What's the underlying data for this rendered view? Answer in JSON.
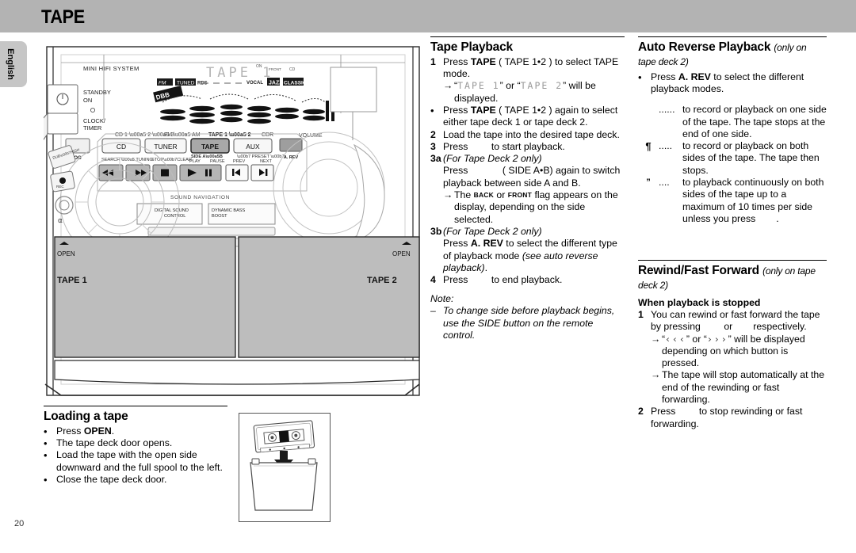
{
  "page": {
    "title": "TAPE",
    "language_tab": "English",
    "page_number": "20",
    "header_bg": "#b3b3b3"
  },
  "illustration": {
    "name": "mini-hifi-front-panel",
    "labels": {
      "brand": "MINI HIFI SYSTEM",
      "standby": "STANDBY",
      "on": "ON",
      "clock_timer_1": "CLOCK/",
      "clock_timer_2": "TIMER",
      "dubbing": "DUB· HIGH",
      "record": "REC",
      "prog": "PROG",
      "source_cd": "CD 1 ¥ 2 ¥ 3",
      "source_fm": "FM ¥ AM",
      "source_tape": "TAPE 1 ¥ 2",
      "source_cdr": "CDR",
      "btn_cd": "CD",
      "btn_tuner": "TUNER",
      "btn_tape": "TAPE",
      "btn_aux": "AUX",
      "btn_arev": "A. REV",
      "volume": "VOLUME",
      "search_tuning": "SEARCH ¥ TUNING",
      "stop_clear": "STOP·CLEAR",
      "side_ab": "SIDE A¥B",
      "play": "PLAY",
      "pause": "PAUSE",
      "preset": "· PRESET ·",
      "prev": "PREV",
      "next": "NEXT",
      "sound_navigation": "SOUND NAVIGATION",
      "dsc_1": "DIGITAL SOUND",
      "dsc_2": "CONTROL",
      "dbb_1": "DYNAMIC BASS",
      "dbb_2": "BOOST",
      "open_left": "OPEN",
      "open_right": "OPEN",
      "tape1": "TAPE 1",
      "tape2": "TAPE 2"
    },
    "display": {
      "main_text": "TAPE  1",
      "flags": [
        "FM",
        "TUNED",
        "RDS",
        "ON",
        "FRONT",
        "CD",
        "VOCAL",
        "JAZZ",
        "CLASSIC"
      ],
      "logo": "DBB"
    }
  },
  "loading_a_tape": {
    "heading": "Loading a tape",
    "bullets": [
      {
        "pre": "Press ",
        "bold": "OPEN",
        "post": "."
      },
      {
        "pre": "The tape deck door opens.",
        "bold": "",
        "post": ""
      },
      {
        "pre": "Load the tape with the open side downward and the full spool to the left.",
        "bold": "",
        "post": ""
      },
      {
        "pre": "Close the tape deck door.",
        "bold": "",
        "post": ""
      }
    ]
  },
  "tape_playback": {
    "heading": "Tape Playback",
    "steps": [
      {
        "marker": "1",
        "line1_a": "Press ",
        "line1_bold": "TAPE",
        "line1_b": " ( TAPE 1•2 ) to select TAPE mode.",
        "arrow": {
          "q1": "“",
          "lcd1": "TAPE  1",
          "q2": "” or “",
          "lcd2": "TAPE  2",
          "q3": "” will be displayed."
        }
      },
      {
        "marker": "•",
        "line1_a": "Press ",
        "line1_bold": "TAPE",
        "line1_b": " ( TAPE 1•2 ) again to select either tape deck 1 or tape deck 2."
      },
      {
        "marker": "2",
        "text": "Load the tape into the desired tape deck."
      },
      {
        "marker": "3",
        "pre": "Press ",
        "post": "to start playback."
      },
      {
        "marker": "3a",
        "italic_head": "(For Tape Deck 2 only)",
        "pre": "Press ",
        "post": "( SIDE A•B) again to switch playback between side A and B.",
        "arrow_pre": "The ",
        "arrow_sc1": "BACK",
        "arrow_mid": " or ",
        "arrow_sc2": "FRONT",
        "arrow_post": " flag appears on the display, depending on the side selected."
      },
      {
        "marker": "3b",
        "italic_head": "(For Tape Deck 2 only)",
        "pre": "Press ",
        "bold": "A. REV",
        "post": " to select the different type of playback mode ",
        "italic_tail": "(see auto reverse playback)",
        "tail_end": "."
      },
      {
        "marker": "4",
        "pre": "Press ",
        "post": "to end playback."
      }
    ],
    "note": {
      "head": "Note:",
      "items": [
        "To change side before playback begins, use the SIDE button on the remote control."
      ]
    }
  },
  "auto_reverse": {
    "heading": "Auto Reverse Playback",
    "heading_sub": "(only on tape deck 2)",
    "bullet": {
      "pre": "Press ",
      "bold": "A. REV",
      "post": " to select the different playback modes."
    },
    "modes": [
      {
        "symbol": "",
        "dots": "......",
        "text": "to record or playback on one side of the tape. The tape stops at the end of one side."
      },
      {
        "symbol": "¶",
        "dots": ".....",
        "text": "to record or playback on both sides of the tape. The tape then stops."
      },
      {
        "symbol": "”",
        "dots": "....",
        "text": "to playback continuously on both sides of the tape up to a maximum of 10 times per side unless you press",
        "trailing": "."
      }
    ]
  },
  "rewind_ff": {
    "heading": "Rewind/Fast Forward",
    "heading_sub": "(only on tape deck 2)",
    "subheading": "When playback is stopped",
    "steps": [
      {
        "marker": "1",
        "pre": "You can rewind or fast forward the tape by pressing ",
        "mid": "or",
        "post": "respectively.",
        "arrow1": {
          "q1": "“",
          "sym1": "‹‹‹",
          "q2": "” or “",
          "sym2": "›››",
          "q3": "” will be displayed depending on which button is pressed."
        },
        "arrow2": "The tape will stop automatically at the end of the rewinding or fast forwarding."
      },
      {
        "marker": "2",
        "pre": "Press ",
        "post": "to stop rewinding or fast forwarding."
      }
    ]
  }
}
